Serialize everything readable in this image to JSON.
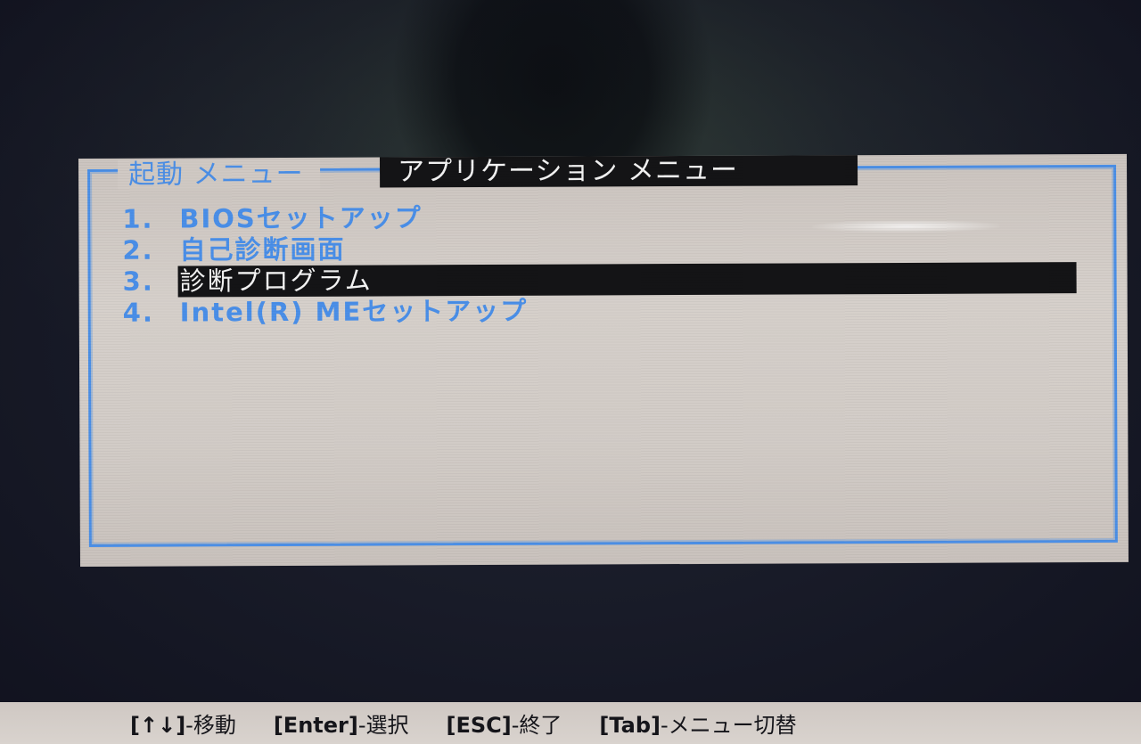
{
  "tabs": [
    {
      "label": "起動 メニュー",
      "active": false
    },
    {
      "label": "アプリケーション メニュー",
      "active": true
    }
  ],
  "menu": {
    "items": [
      {
        "number": "1.",
        "label": "BIOSセットアップ",
        "selected": false
      },
      {
        "number": "2.",
        "label": "自己診断画面",
        "selected": false
      },
      {
        "number": "3.",
        "label": "診断プログラム",
        "selected": true
      },
      {
        "number": "4.",
        "label": "Intel(R) MEセットアップ",
        "selected": false
      }
    ]
  },
  "status_bar": {
    "hints": [
      {
        "key": "[↑↓]",
        "action": "-移動"
      },
      {
        "key": "[Enter]",
        "action": "-選択"
      },
      {
        "key": "[ESC]",
        "action": "-終了"
      },
      {
        "key": "[Tab]",
        "action": "-メニュー切替"
      }
    ]
  },
  "colors": {
    "accent": "#4b8fe6",
    "panel_bg": "#d2ccc7",
    "selected_bg": "#141416",
    "selected_fg": "#f4f4f4",
    "status_bar_bg": "#d5cfca"
  }
}
